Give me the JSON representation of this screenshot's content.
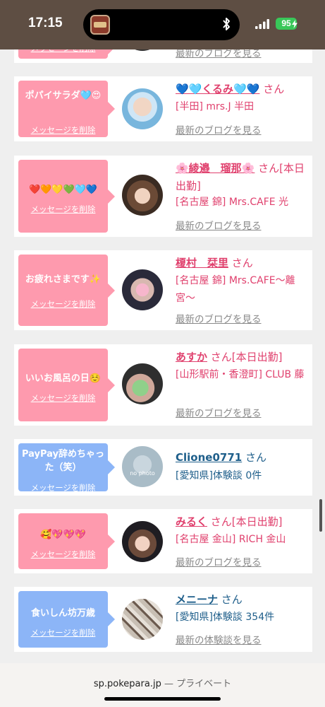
{
  "status_bar": {
    "time": "17:15",
    "battery": "95",
    "icons": [
      "island-thumbnail-icon",
      "bluetooth-icon",
      "signal-icon",
      "wifi-icon",
      "battery-icon",
      "charging-bolt-icon"
    ]
  },
  "colors": {
    "status_bar_bg": "#5e4e43",
    "pink_bubble": "#fe9aae",
    "blue_bubble": "#8cb5f7",
    "pink_text": "#e0416e",
    "blue_text": "#1f5f8b",
    "battery_green": "#39c759"
  },
  "partial_top": {
    "delete_label": "メッセージを削除",
    "blog_link": "最新のブログを見る"
  },
  "cards": [
    {
      "message": "ポパイサラダ🩵😍",
      "delete_label": "メッセージを削除",
      "name": "💙🩵くるみ🩵💙",
      "honorific": "さん",
      "shop": "[半田] mrs.J 半田",
      "link": "最新のブログを見る"
    },
    {
      "message": "❤️🧡💛💚🩵💙",
      "delete_label": "メッセージを削除",
      "name": "🌸綾邉　瑠那🌸",
      "honorific": "さん[本日出勤]",
      "shop": "[名古屋 錦] Mrs.CAFE 光",
      "link": "最新のブログを見る"
    },
    {
      "message": "お疲れさまです✨",
      "delete_label": "メッセージを削除",
      "name": "榎村　栞里",
      "honorific": "さん",
      "shop": "[名古屋 錦] Mrs.CAFE〜離宮〜",
      "link": "最新のブログを見る"
    },
    {
      "message": "いいお風呂の日☺️",
      "delete_label": "メッセージを削除",
      "name": "あすか",
      "honorific": "さん[本日出勤]",
      "shop": "[山形駅前・香澄町] CLUB 藤",
      "link": "最新のブログを見る"
    },
    {
      "message": "PayPay辞めちゃった（笑）",
      "delete_label": "メッセージを削除",
      "avatar_text": "no photo",
      "name": "Clione0771",
      "honorific": "さん",
      "shop": "[愛知県]体験談 0件",
      "link": ""
    },
    {
      "message": "🥰💖💖💖",
      "delete_label": "メッセージを削除",
      "name": "みるく",
      "honorific": "さん[本日出勤]",
      "shop": "[名古屋 金山] RICH 金山",
      "link": "最新のブログを見る"
    },
    {
      "message": "食いしん坊万歳",
      "delete_label": "メッセージを削除",
      "name": "メニーナ",
      "honorific": "さん",
      "shop": "[愛知県]体験談 354件",
      "link": "最新の体験談を見る"
    }
  ],
  "footer": {
    "domain": "sp.pokepara.jp",
    "separator": "—",
    "mode": "プライベート"
  }
}
